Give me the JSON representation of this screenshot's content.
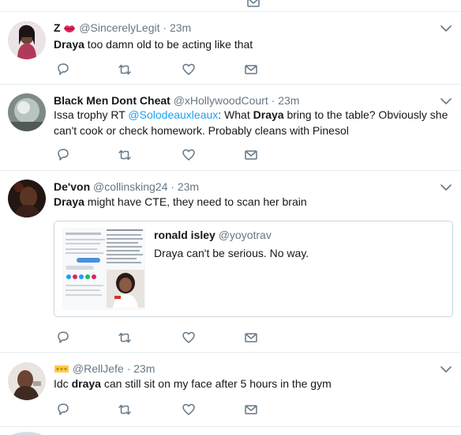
{
  "tweets": [
    {
      "name_prefix": "Z",
      "name_emoji": "lips-emoji",
      "handle": "@SincerelyLegit",
      "time": "23m",
      "text_parts": [
        {
          "t": "Draya",
          "b": true
        },
        {
          "t": " too damn old to be acting like that",
          "b": false
        }
      ]
    },
    {
      "name": "Black Men Dont Cheat",
      "handle": "@xHollywoodCourt",
      "time": "23m",
      "line1_parts": [
        {
          "t": "Issa trophy  RT ",
          "b": false
        },
        {
          "t": "@Solodeauxleaux",
          "m": true
        },
        {
          "t": ": What ",
          "b": false
        },
        {
          "t": "Draya",
          "b": true
        },
        {
          "t": " bring to the table? Obviously she",
          "b": false
        }
      ],
      "line2": "can't cook or check homework. Probably cleans with Pinesol"
    },
    {
      "name": "De'von",
      "handle": "@collinsking24",
      "time": "23m",
      "text_parts": [
        {
          "t": "Draya",
          "b": true
        },
        {
          "t": " might have CTE, they need to scan her brain",
          "b": false
        }
      ],
      "quote": {
        "name": "ronald isley",
        "handle": "@yoyotrav",
        "text": "Draya can't be serious. No way."
      }
    },
    {
      "name_emoji": "crown-emoji",
      "handle": "@RellJefe",
      "time": "23m",
      "text_parts": [
        {
          "t": "Idc ",
          "b": false
        },
        {
          "t": "draya",
          "b": true
        },
        {
          "t": " can still sit on my face after 5 hours in the gym",
          "b": false
        }
      ]
    }
  ],
  "separator": "·",
  "icons": [
    "reply-icon",
    "retweet-icon",
    "like-icon",
    "dm-icon",
    "chevron-down-icon"
  ],
  "colors": {
    "text": "#14171a",
    "secondary": "#657786",
    "link": "#1da1f2",
    "border": "#e6ecf0",
    "icon": "#657786"
  }
}
